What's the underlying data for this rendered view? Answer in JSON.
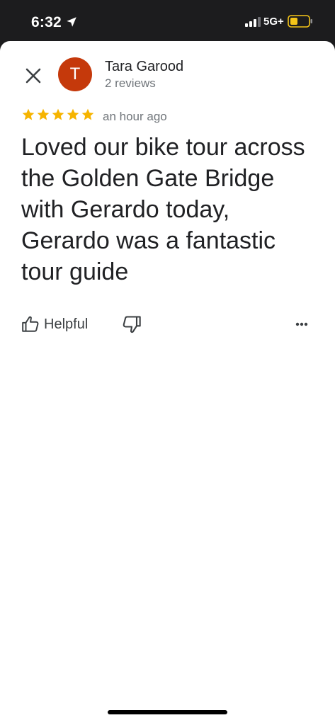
{
  "status_bar": {
    "time": "6:32",
    "network": "5G+",
    "battery_color": "#f5c518"
  },
  "review": {
    "reviewer_initial": "T",
    "avatar_color": "#c5390b",
    "reviewer_name": "Tara Garood",
    "reviewer_count": "2 reviews",
    "rating": 5,
    "rating_max": 5,
    "time_ago": "an hour ago",
    "text": "Loved our bike tour across the Golden Gate Bridge with Gerardo today, Gerardo was a fantastic tour guide"
  },
  "actions": {
    "helpful_label": "Helpful",
    "helpful_icon": "thumbs-up-icon",
    "dislike_icon": "thumbs-down-icon",
    "more_icon": "more-horizontal-icon",
    "close_icon": "close-icon"
  }
}
